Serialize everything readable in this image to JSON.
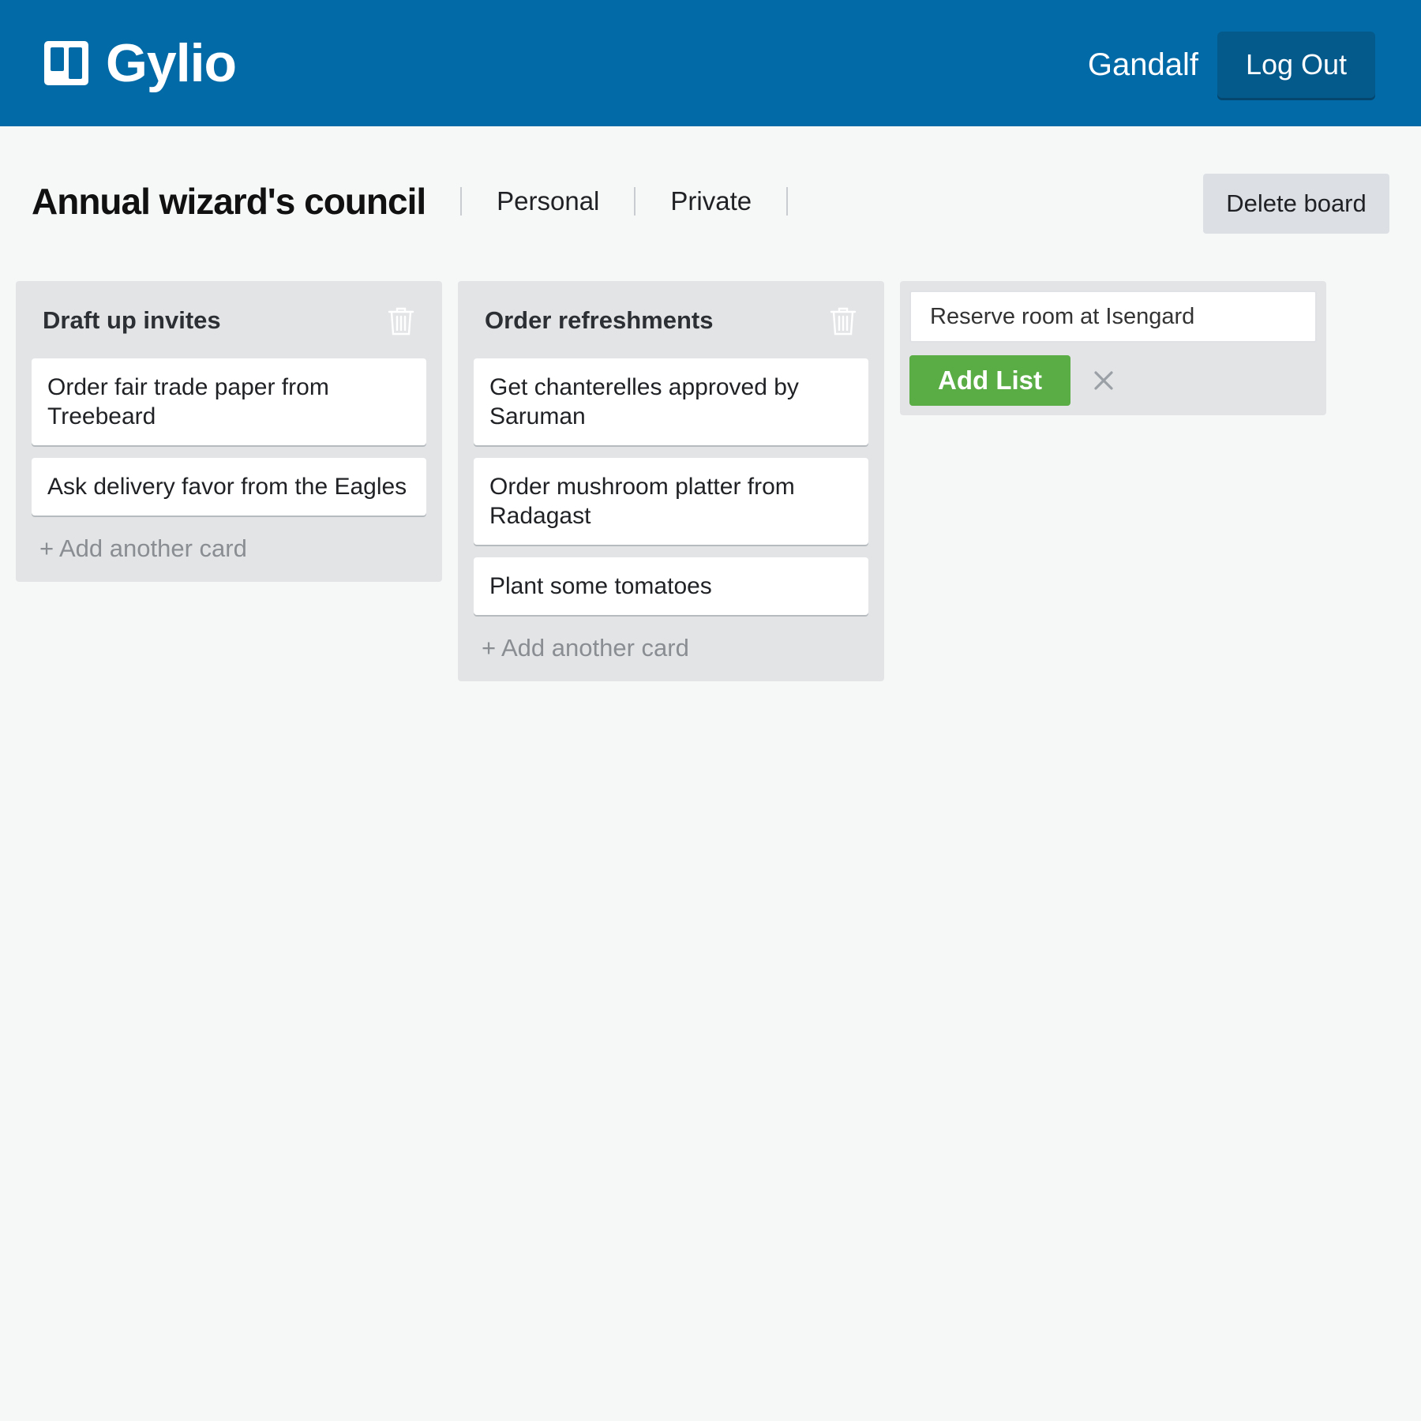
{
  "app": {
    "name": "Gylio"
  },
  "user": {
    "name": "Gandalf",
    "logout_label": "Log Out"
  },
  "board": {
    "title": "Annual wizard's council",
    "team": "Personal",
    "visibility": "Private",
    "delete_label": "Delete board"
  },
  "lists": [
    {
      "title": "Draft up invites",
      "cards": [
        "Order fair trade paper from Treebeard",
        "Ask delivery favor from the Eagles"
      ],
      "add_card_label": "+ Add another card"
    },
    {
      "title": "Order refreshments",
      "cards": [
        "Get chanterelles approved by Saruman",
        "Order mushroom platter from Radagast",
        "Plant some tomatoes"
      ],
      "add_card_label": "+ Add another card"
    }
  ],
  "composer": {
    "input_value": "Reserve room at Isengard",
    "submit_label": "Add List"
  },
  "icons": {
    "logo": "board-logo-icon",
    "trash": "trash-icon",
    "close": "close-icon"
  },
  "colors": {
    "header": "#026aa7",
    "logout_button": "#055a8c",
    "add_list_button": "#5aac44",
    "list_background": "#e2e4e6"
  }
}
